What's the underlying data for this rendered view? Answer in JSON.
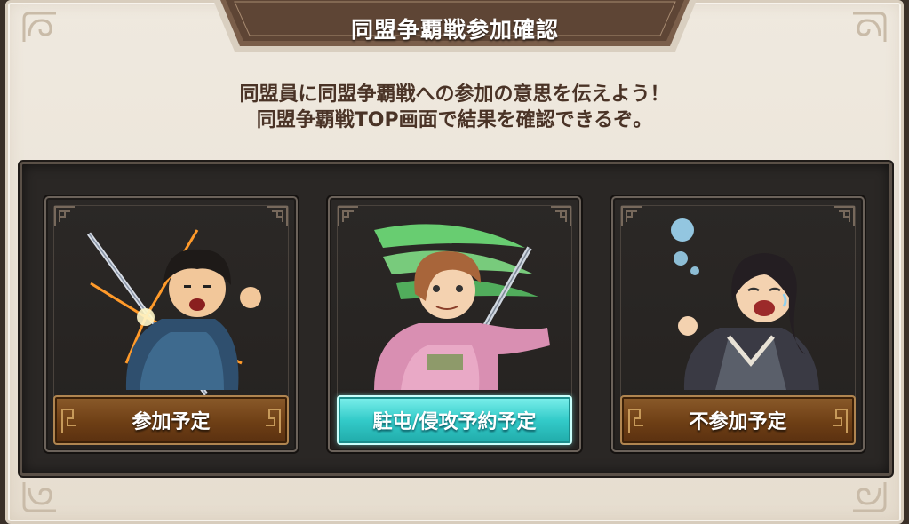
{
  "dialog": {
    "title": "同盟争覇戦参加確認",
    "message_line1": "同盟員に同盟争覇戦への参加の意思を伝えよう！",
    "message_line2": "同盟争覇戦TOP画面で結果を確認できるぞ。"
  },
  "options": [
    {
      "label": "参加予定",
      "style": "brown",
      "character_icon": "swordsman-shouting-icon"
    },
    {
      "label": "駐屯/侵攻予約予定",
      "style": "teal",
      "character_icon": "swordswoman-pointing-icon"
    },
    {
      "label": "不参加予定",
      "style": "brown",
      "character_icon": "crying-strategist-icon"
    }
  ],
  "colors": {
    "parchment": "#ece5da",
    "title_banner": "#6b5140",
    "dark_area": "#2a2725",
    "brown_button": "#6e3f15",
    "teal_button": "#33cbc9",
    "message_text": "#4a3326"
  }
}
